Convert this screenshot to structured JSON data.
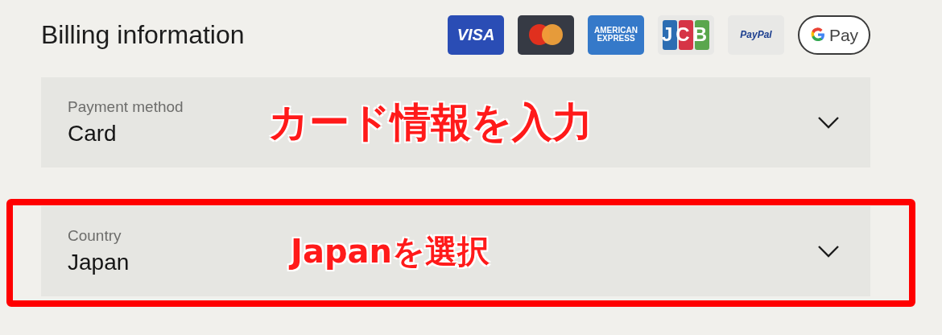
{
  "title": "Billing information",
  "payment_logos": [
    {
      "kind": "visa",
      "text": "VISA"
    },
    {
      "kind": "mastercard"
    },
    {
      "kind": "amex",
      "text": "AMERICAN EXPRESS"
    },
    {
      "kind": "jcb",
      "text": "JCB"
    },
    {
      "kind": "paypal",
      "text": "PayPal"
    },
    {
      "kind": "gpay",
      "text": "Pay"
    }
  ],
  "fields": [
    {
      "label": "Payment method",
      "value": "Card",
      "annotation": "カード情報を入力",
      "highlighted": false
    },
    {
      "label": "Country",
      "value": "Japan",
      "annotation": "Japanを選択",
      "highlighted": true
    }
  ]
}
